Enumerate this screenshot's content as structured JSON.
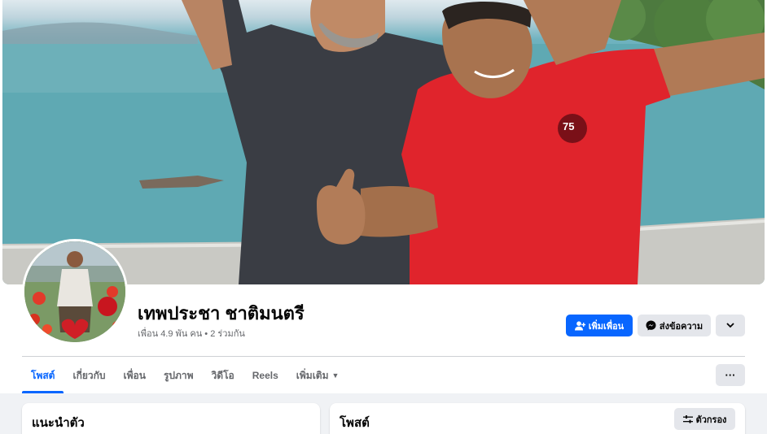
{
  "profile": {
    "name": "เทพประชา ชาติมนตรี",
    "stats": "เพื่อน 4.9 พัน คน • 2 ร่วมกัน",
    "cover_photo_icon": "cover-photo",
    "avatar_icon": "profile-picture",
    "jersey_number": "75"
  },
  "actions": {
    "add_friend_label": "เพิ่มเพื่อน",
    "add_friend_icon": "person-plus-icon",
    "message_label": "ส่งข้อความ",
    "message_icon": "messenger-icon",
    "dropdown_icon": "chevron-down-icon"
  },
  "tabs": [
    {
      "label": "โพสต์",
      "active": true
    },
    {
      "label": "เกี่ยวกับ",
      "active": false
    },
    {
      "label": "เพื่อน",
      "active": false
    },
    {
      "label": "รูปภาพ",
      "active": false
    },
    {
      "label": "วิดีโอ",
      "active": false
    },
    {
      "label": "Reels",
      "active": false
    },
    {
      "label": "เพิ่มเติม",
      "active": false
    }
  ],
  "more_menu_icon": "ellipsis-icon",
  "intro": {
    "title": "แนะนำตัว"
  },
  "posts": {
    "title": "โพสต์",
    "filter_label": "ตัวกรอง",
    "filter_icon": "sliders-icon"
  },
  "colors": {
    "accent": "#0866ff",
    "secondary_button": "#e4e6eb",
    "page_bg": "#f0f2f5",
    "muted_text": "#65676b"
  }
}
